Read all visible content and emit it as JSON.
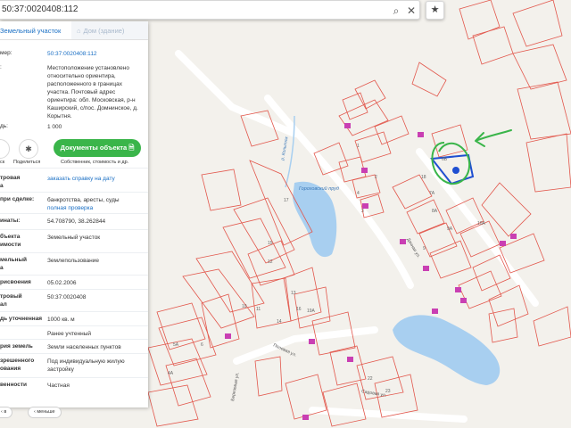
{
  "search": {
    "query": "50:37:0020408:112",
    "search_icon": "magnifier-icon",
    "clear_icon": "close-icon",
    "favorite_icon": "star-icon"
  },
  "tabs": [
    {
      "label": "Земельный участок",
      "active": true
    },
    {
      "label": "Дом (здание)",
      "active": false
    }
  ],
  "details": {
    "cad_number_label": "мер:",
    "cad_number_value": "50:37:0020408:112",
    "address_label": ":",
    "address_value": "Местоположение установлено относительно ориентира, расположенного в границах участка. Почтовый адрес ориентира: обл. Московская, р-н Каширский, с/пос. Домнинское, д. Корытня.",
    "cost_label": "дь:",
    "cost_value": "1 000"
  },
  "actions": {
    "bookmark_caption": "ск",
    "share_caption": "Поделиться",
    "docs_button": "Документы объекта",
    "docs_caption": "Собственник, стоимость и др."
  },
  "info_rows": [
    {
      "label": "тровая",
      "label2": "а",
      "value": "заказать справку на дату",
      "link": true
    },
    {
      "label": "при сделке:",
      "value": "банкротства, аресты, суды",
      "value2": "полная проверка",
      "link2": true
    },
    {
      "label": "инаты:",
      "value": "54.708790, 38.262844"
    },
    {
      "label": "бъекта",
      "label2": "имости",
      "value": "Земельный участок"
    },
    {
      "label": "мельный",
      "label2": "а",
      "value": "Землепользование"
    },
    {
      "label": "рисвоения",
      "value": "05.02.2006"
    },
    {
      "label": "тровый",
      "label2": "ал",
      "value": "50:37:0020408"
    },
    {
      "label": "дь уточненная",
      "value": "1000 кв. м"
    },
    {
      "label": "",
      "value": "Ранее учтенный"
    },
    {
      "label": "рия земель",
      "value": "Земли населенных пунктов"
    },
    {
      "label": "зрешенного",
      "label2": "ования",
      "value": "Под индивидуальную жилую застройку"
    },
    {
      "label": "венности",
      "value": "Частная"
    }
  ],
  "bottom": {
    "back": "в",
    "less": "меньше"
  },
  "map_labels": {
    "pond": "Гороховский пруд",
    "river": "р. Колыток",
    "street1": "Дачная ул.",
    "street2": "Садовая ул.",
    "street3": "Березовая ул.",
    "street4": "Полевая ул.",
    "parcels": [
      "6Б",
      "7А",
      "8А",
      "9А",
      "10А",
      "17",
      "15",
      "11",
      "10",
      "16",
      "19А",
      "22",
      "23",
      "5А",
      "6",
      "4А",
      "4",
      "3",
      "2",
      "1",
      "18",
      "12",
      "13",
      "14",
      "9"
    ]
  },
  "colors": {
    "accent": "#1a6fc4",
    "green": "#3ab54a",
    "parcel_border": "#e2574c",
    "selected_border": "#1f4fd1",
    "water": "#a8cff0"
  }
}
